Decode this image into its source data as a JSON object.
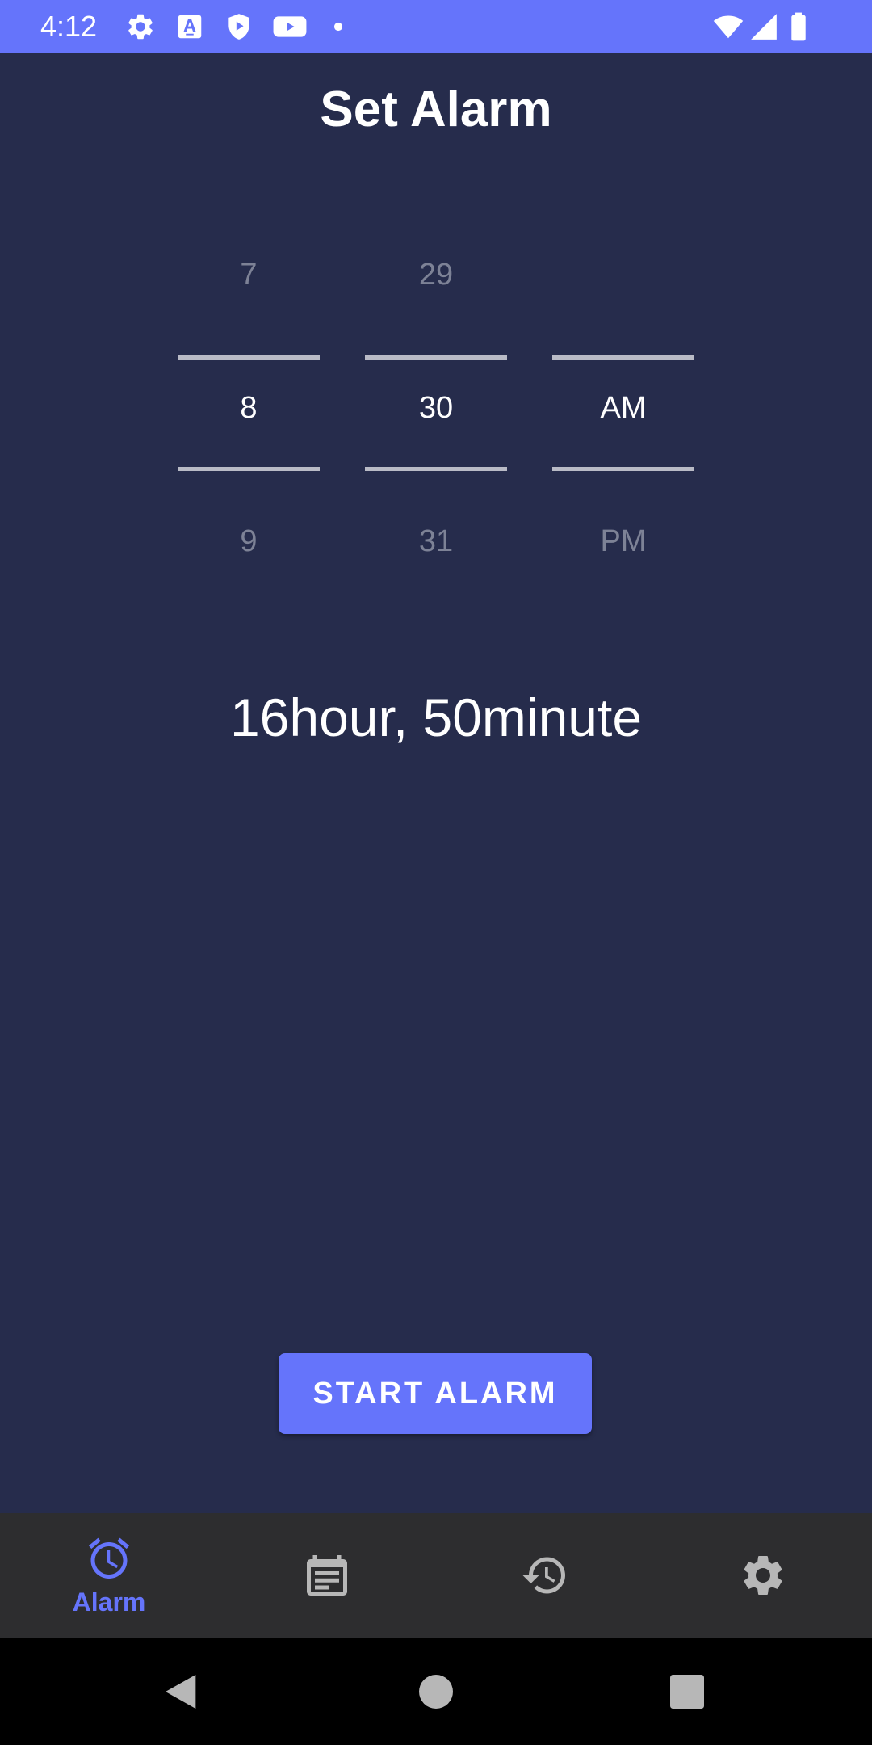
{
  "status_bar": {
    "time": "4:12",
    "icons": [
      "gear-icon",
      "font-a-icon",
      "shield-play-icon",
      "youtube-icon",
      "dot-icon",
      "wifi-icon",
      "cell-signal-icon",
      "battery-icon"
    ],
    "background": "#6574fb"
  },
  "header": {
    "title": "Set Alarm"
  },
  "picker": {
    "hour": {
      "prev": "7",
      "current": "8",
      "next": "9"
    },
    "minute": {
      "prev": "29",
      "current": "30",
      "next": "31"
    },
    "period": {
      "prev": "",
      "current": "AM",
      "next": "PM"
    }
  },
  "remaining_time": "16hour, 50minute",
  "start_button": {
    "label": "START ALARM"
  },
  "bottom_nav": {
    "items": [
      {
        "label": "Alarm",
        "icon": "alarm-clock-icon",
        "active": true
      },
      {
        "label": "",
        "icon": "calendar-note-icon",
        "active": false
      },
      {
        "label": "",
        "icon": "history-icon",
        "active": false
      },
      {
        "label": "",
        "icon": "settings-gear-icon",
        "active": false
      }
    ]
  },
  "system_nav": {
    "icons": [
      "back-icon",
      "home-icon",
      "recents-icon"
    ]
  },
  "colors": {
    "background": "#262c4c",
    "accent": "#6574fb",
    "nav_background": "#2d2d2f",
    "inactive_icon": "#b7b7b7",
    "muted_text": "#7d8296"
  }
}
